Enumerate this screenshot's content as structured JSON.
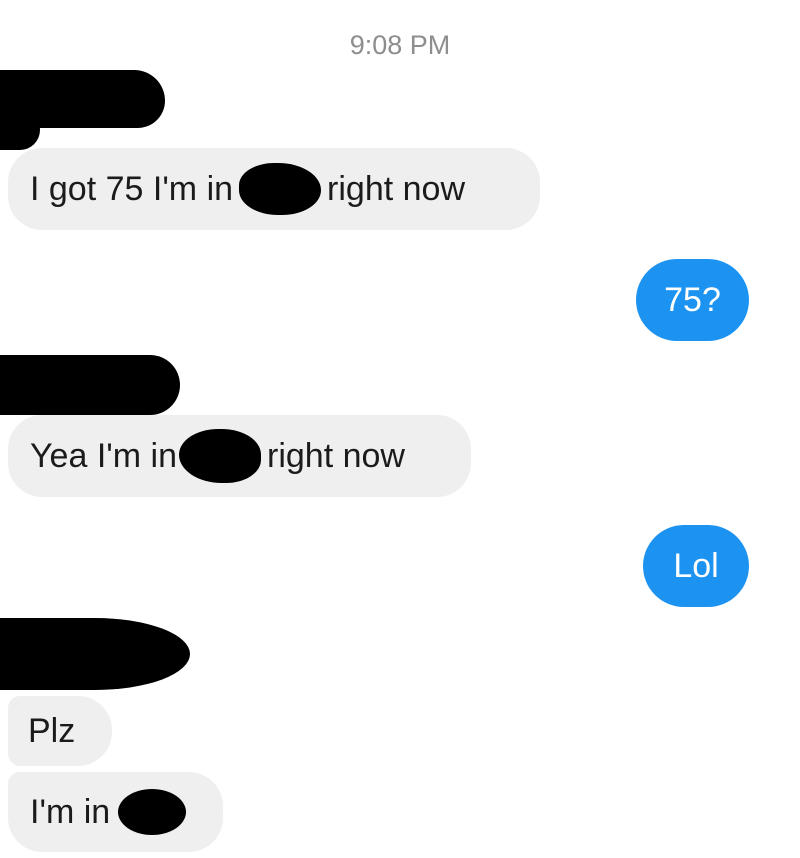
{
  "conversation": {
    "timestamp": "9:08 PM",
    "messages": [
      {
        "direction": "incoming",
        "before": "I got 75 I'm in",
        "after": "right now"
      },
      {
        "direction": "outgoing",
        "text": "75?"
      },
      {
        "direction": "incoming",
        "before": "Yea I'm in",
        "after": "right now"
      },
      {
        "direction": "outgoing",
        "text": "Lol"
      },
      {
        "direction": "incoming",
        "text": "Plz"
      },
      {
        "direction": "incoming",
        "before": "I'm in",
        "after": ""
      }
    ]
  },
  "colors": {
    "incoming_bubble": "#efefef",
    "outgoing_bubble": "#1d93f1",
    "incoming_text": "#1b1b1b",
    "outgoing_text": "#ffffff",
    "timestamp_text": "#8e8e8e"
  }
}
